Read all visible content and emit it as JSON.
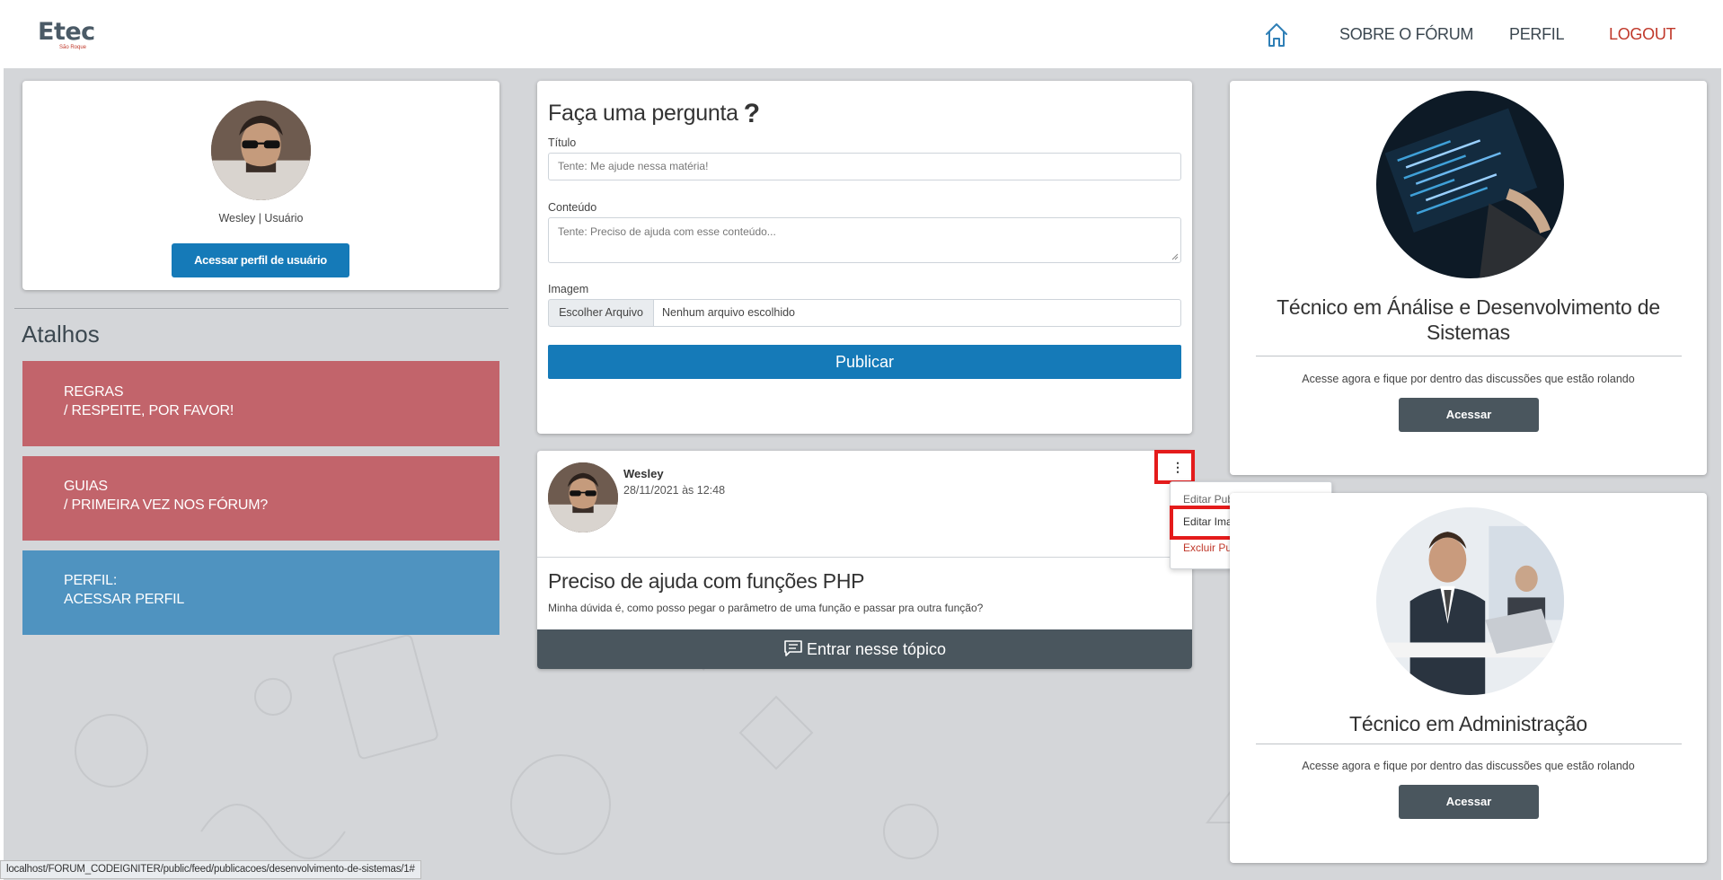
{
  "header": {
    "brand": "Etec",
    "brand_sub": "São Roque",
    "nav": {
      "home_icon": "home-icon",
      "about": "SOBRE O FÓRUM",
      "profile": "PERFIL",
      "logout": "LOGOUT"
    },
    "logout_color": "#c0392b"
  },
  "profile_card": {
    "name": "Wesley | Usuário",
    "button_label": "Acessar perfil de usuário"
  },
  "shortcuts": {
    "title": "Atalhos",
    "items": [
      {
        "line1": "REGRAS",
        "line2": "/ RESPEITE, POR FAVOR!",
        "color": "#c2646b"
      },
      {
        "line1": "GUIAS",
        "line2": "/ PRIMEIRA VEZ NOS FÓRUM?",
        "color": "#c2646b"
      },
      {
        "line1": "PERFIL:",
        "line2": "ACESSAR PERFIL",
        "color": "#4f93c0"
      }
    ]
  },
  "question_form": {
    "title": "Faça uma pergunta",
    "title_icon": "?",
    "title_label": "Título",
    "title_placeholder": "Tente: Me ajude nessa matéria!",
    "content_label": "Conteúdo",
    "content_placeholder": "Tente: Preciso de ajuda com esse conteúdo...",
    "image_label": "Imagem",
    "file_button": "Escolher Arquivo",
    "file_status": "Nenhum arquivo escolhido",
    "publish_button": "Publicar"
  },
  "post": {
    "author": "Wesley",
    "date": "28/11/2021 às 12:48",
    "menu_icon": "⋮",
    "menu": {
      "edit": "Editar Publicação",
      "edit_image": "Editar Imagem Publicação",
      "delete": "Excluir Publicação"
    },
    "title": "Preciso de ajuda com funções PHP",
    "description": "Minha dúvida é, como posso pegar o parâmetro de uma função e passar pra outra função?",
    "enter_button": "Entrar nesse tópico"
  },
  "courses": [
    {
      "title": "Técnico em Ánálise e Desenvolvimento de Sistemas",
      "text": "Acesse agora e fique por dentro das discussões que estão rolando",
      "button": "Acessar"
    },
    {
      "title": "Técnico em Administração",
      "text": "Acesse agora e fique por dentro das discussões que estão rolando",
      "button": "Acessar"
    }
  ],
  "status_bar": "localhost/FORUM_CODEIGNITER/public/feed/publicacoes/desenvolvimento-de-sistemas/1#",
  "colors": {
    "primary": "#157ab8",
    "dark_button": "#4a565e",
    "highlight": "#e41b1b",
    "background": "#d4d6d9"
  }
}
